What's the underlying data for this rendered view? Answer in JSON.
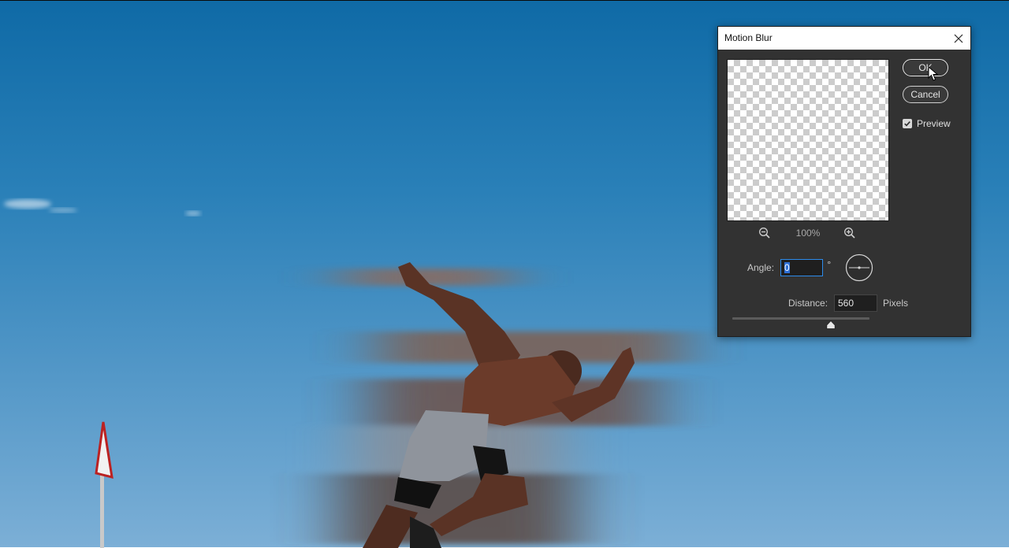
{
  "dialog": {
    "title": "Motion Blur",
    "ok_label": "OK",
    "cancel_label": "Cancel",
    "preview_label": "Preview",
    "preview_checked": true,
    "zoom_level": "100%",
    "angle_label": "Angle:",
    "angle_value": "0",
    "angle_unit": "°",
    "distance_label": "Distance:",
    "distance_value": "560",
    "distance_unit": "Pixels"
  },
  "icons": {
    "close": "close-icon",
    "zoom_out": "zoom-out-icon",
    "zoom_in": "zoom-in-icon",
    "checkbox": "checkmark-icon",
    "angle_dial": "angle-dial-icon",
    "slider_thumb": "slider-thumb-icon",
    "cursor": "mouse-cursor-icon"
  },
  "colors": {
    "dialog_bg": "#323232",
    "titlebar_bg": "#ffffff",
    "input_focus": "#2d8ceb",
    "sky_top": "#0f6aa6",
    "sky_bottom": "#7cafd6"
  }
}
